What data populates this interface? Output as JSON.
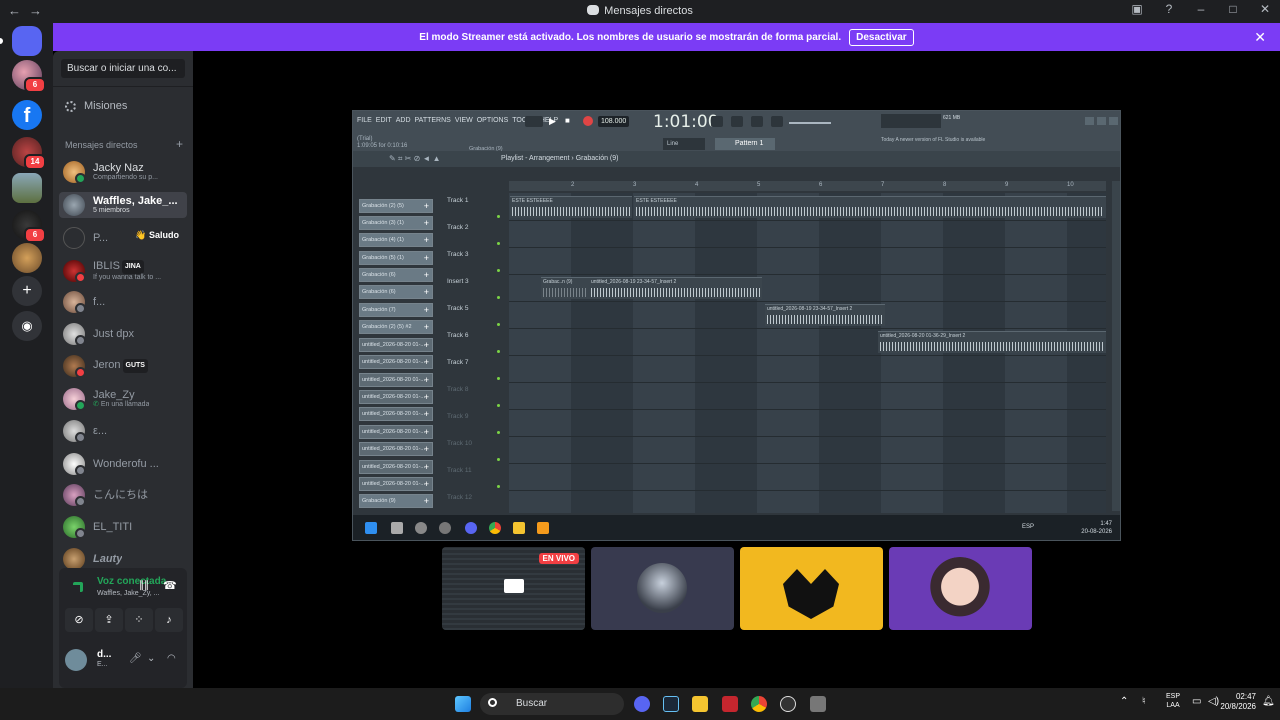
{
  "window": {
    "title": "Mensajes directos",
    "back_icon": "arrow-left-icon",
    "forward_icon": "arrow-right-icon"
  },
  "banner": {
    "message": "El modo Streamer está activado. Los nombres de usuario se mostrarán de forma parcial.",
    "button": "Desactivar",
    "color": "#7b3cf5"
  },
  "servers": [
    {
      "name": "discord-home",
      "badge": ""
    },
    {
      "name": "server-avatar-1",
      "badge": "6"
    },
    {
      "name": "facebook-server",
      "badge": ""
    },
    {
      "name": "server-avatar-2",
      "badge": "14"
    },
    {
      "name": "server-avatar-3",
      "badge": ""
    },
    {
      "name": "server-avatar-4",
      "badge": "6"
    },
    {
      "name": "server-avatar-5",
      "badge": ""
    }
  ],
  "sidebar": {
    "search_placeholder": "Buscar o iniciar una co...",
    "misiones": "Misiones",
    "dm_header": "Mensajes directos",
    "dms": [
      {
        "name": "Jacky Naz",
        "sub": "Compartiendo su p...",
        "tag": "",
        "extra": ""
      },
      {
        "name": "Waffles, Jake_...",
        "sub": "5 miembros",
        "tag": "",
        "extra": ""
      },
      {
        "name": "P...",
        "sub": "",
        "tag": "",
        "extra": "👋 Saludo"
      },
      {
        "name": "IBLIS",
        "sub": "If you wanna talk to ...",
        "tag": "JINA",
        "extra": ""
      },
      {
        "name": "f...",
        "sub": "",
        "tag": "",
        "extra": ""
      },
      {
        "name": "Just dpx",
        "sub": "",
        "tag": "",
        "extra": ""
      },
      {
        "name": "Jeron",
        "sub": "",
        "tag": "GUTS",
        "extra": ""
      },
      {
        "name": "Jake_Zy",
        "sub": "En una llamada",
        "tag": "",
        "extra": ""
      },
      {
        "name": "ε...",
        "sub": "",
        "tag": "",
        "extra": ""
      },
      {
        "name": "Wonderofu ...",
        "sub": "",
        "tag": "",
        "extra": ""
      },
      {
        "name": "こんにちは",
        "sub": "",
        "tag": "",
        "extra": ""
      },
      {
        "name": "EL_TITI",
        "sub": "",
        "tag": "",
        "extra": ""
      },
      {
        "name": "Lauty",
        "sub": "",
        "tag": "",
        "extra": ""
      }
    ],
    "voice": {
      "status": "Voz conectada",
      "channel": "Waffles, Jake_Zy, ..."
    },
    "user": {
      "name": "d...",
      "status": "E..."
    }
  },
  "fl": {
    "menu": [
      "FILE",
      "EDIT",
      "ADD",
      "PATTERNS",
      "VIEW",
      "OPTIONS",
      "TOOLS",
      "HELP"
    ],
    "trial": "(Trial)",
    "hint": "1:09:05 for 0:10:16",
    "recording_tag": "Grabación (9)",
    "tempo": "108.000",
    "time": "1:01:00",
    "mem": "621 MB",
    "line_mode": "Line",
    "pattern": "Pattern 1",
    "news": "Today  A newer version of FL Studio is available",
    "playlist_title": "Playlist - Arrangement › Grabación (9)",
    "ruler": [
      "2",
      "3",
      "4",
      "5",
      "6",
      "7",
      "8",
      "9",
      "10"
    ],
    "channels": [
      "Grabación (2) (5)",
      "Grabación (3) (1)",
      "Grabación (4) (1)",
      "Grabación (5) (1)",
      "Grabación (6)",
      "Grabación (6)",
      "Grabación (7)",
      "Grabación (2) (5) #2",
      "untitled_2026-08-20 01-...",
      "untitled_2026-08-20 01-...",
      "untitled_2026-08-20 01-...",
      "untitled_2026-08-20 01-...",
      "untitled_2026-08-20 01-...",
      "untitled_2026-08-20 01-...",
      "untitled_2026-08-20 01-...",
      "untitled_2026-08-20 01-...",
      "untitled_2026-08-20 01-...",
      "Grabación (9)"
    ],
    "tracks": [
      "Track 1",
      "Track 2",
      "Track 3",
      "Insert 3",
      "Track 5",
      "Track 6",
      "Track 7",
      "Track 8",
      "Track 9",
      "Track 10",
      "Track 11",
      "Track 12"
    ],
    "clips": [
      {
        "label": "ESTE ESTEEEEE"
      },
      {
        "label": "ESTE ESTEEEEE"
      },
      {
        "label": "Grabac..n (9)"
      },
      {
        "label": "untitled_2026-08-19 23-34-57_Insert 2"
      },
      {
        "label": "untitled_2026-08-19 23-34-57_Insert 2"
      },
      {
        "label": "untitled_2026-08-20 01-36-29_Insert 2"
      }
    ],
    "taskbar": {
      "lang": "ESP",
      "time": "1:47",
      "date": "20-08-2026"
    }
  },
  "tiles": [
    {
      "name": "screen-share-tile",
      "live": "EN VIVO"
    },
    {
      "name": "participant-wolf-tile",
      "live": ""
    },
    {
      "name": "participant-yellow-tile",
      "live": ""
    },
    {
      "name": "participant-anime-tile",
      "live": ""
    }
  ],
  "taskbar": {
    "search": "Buscar",
    "lang_top": "ESP",
    "lang_bottom": "LAA",
    "time": "02:47",
    "date": "20/8/2026"
  }
}
